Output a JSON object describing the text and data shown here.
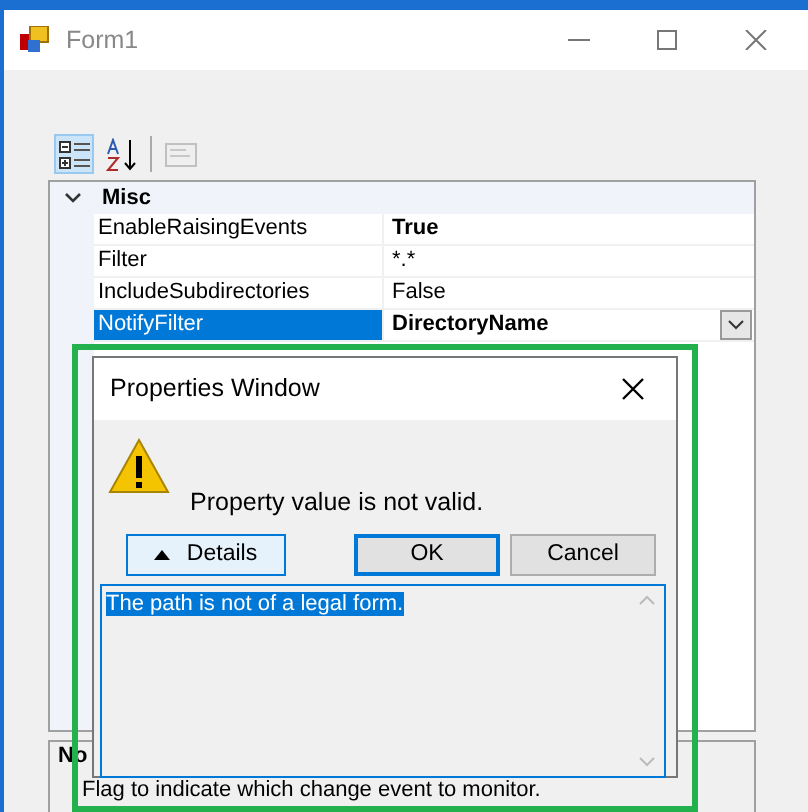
{
  "window": {
    "title": "Form1"
  },
  "toolbar": [
    {
      "kind": "categorized",
      "selected": true,
      "disabled": false
    },
    {
      "kind": "alphabetical",
      "selected": false,
      "disabled": false
    },
    {
      "kind": "pages",
      "selected": false,
      "disabled": true
    }
  ],
  "property_grid": {
    "category": {
      "label": "Misc",
      "expanded": true
    },
    "rows": [
      {
        "name": "EnableRaisingEvents",
        "value": "True",
        "modified": true,
        "selected": false
      },
      {
        "name": "Filter",
        "value": "*.*",
        "modified": false,
        "selected": false
      },
      {
        "name": "IncludeSubdirectories",
        "value": "False",
        "modified": false,
        "selected": false
      },
      {
        "name": "NotifyFilter",
        "value": "DirectoryName",
        "modified": true,
        "selected": true
      }
    ]
  },
  "description": {
    "title": "No",
    "text": "Flag to indicate which change event to monitor."
  },
  "dialog": {
    "title": "Properties Window",
    "message": "Property value is not valid.",
    "buttons": [
      {
        "label": "Details",
        "kind": "toggle",
        "expanded": true
      },
      {
        "label": "OK",
        "kind": "default"
      },
      {
        "label": "Cancel",
        "kind": "normal"
      }
    ],
    "details": {
      "text": "The path is not of a legal form.",
      "selected": true
    }
  }
}
